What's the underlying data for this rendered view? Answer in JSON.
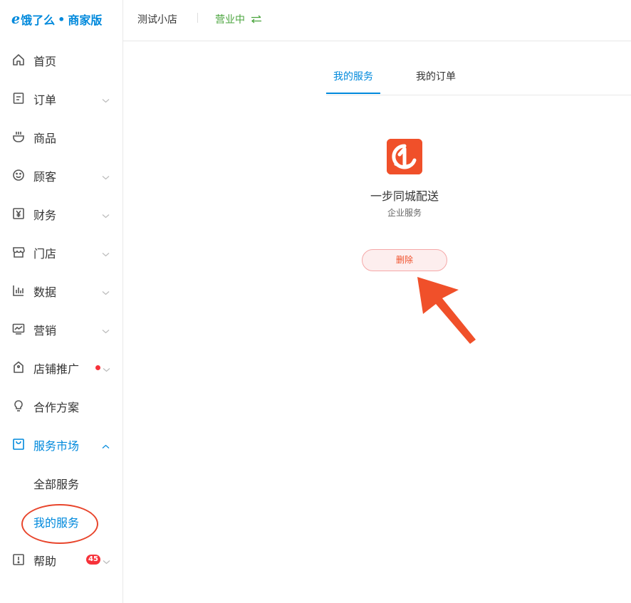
{
  "header": {
    "logo_text": "饿了么",
    "logo_dot": "•",
    "logo_suffix": "商家版",
    "shop_name": "测试小店",
    "status": "营业中"
  },
  "sidebar": {
    "items": [
      {
        "label": "首页",
        "icon": "home-icon"
      },
      {
        "label": "订单",
        "icon": "order-icon"
      },
      {
        "label": "商品",
        "icon": "product-icon"
      },
      {
        "label": "顾客",
        "icon": "smile-icon"
      },
      {
        "label": "财务",
        "icon": "yuan-icon"
      },
      {
        "label": "门店",
        "icon": "store-icon"
      },
      {
        "label": "数据",
        "icon": "bar-chart-icon"
      },
      {
        "label": "营销",
        "icon": "trend-icon"
      },
      {
        "label": "店铺推广",
        "icon": "tag-icon"
      },
      {
        "label": "合作方案",
        "icon": "bulb-icon"
      },
      {
        "label": "服务市场",
        "icon": "bag-icon"
      },
      {
        "label": "帮助",
        "icon": "help-icon",
        "badge": "45"
      }
    ],
    "sub_items": [
      "全部服务",
      "我的服务"
    ]
  },
  "main": {
    "tabs": [
      "我的服务",
      "我的订单"
    ],
    "service": {
      "name": "一步同城配送",
      "category": "企业服务",
      "delete_label": "删除"
    }
  },
  "colors": {
    "accent": "#0089dc",
    "status_green": "#4aa43d",
    "danger": "#f6323a",
    "annotation": "#e8452c"
  }
}
